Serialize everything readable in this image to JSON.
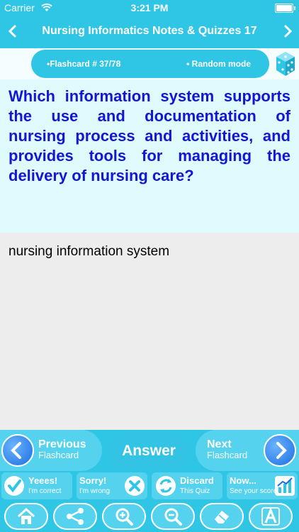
{
  "status": {
    "carrier": "Carrier",
    "time": "3:21 PM"
  },
  "nav": {
    "title": "Nursing Informatics Notes & Quizzes 17"
  },
  "flashcard": {
    "number": "•Flashcard #  37/78",
    "mode": "• Random mode"
  },
  "question": "Which information system supports the use and documentation of nursing process and activities, and provides tools for managing the delivery of nursing care?",
  "answer": "nursing information system",
  "controls": {
    "previous": {
      "line1": "Previous",
      "line2": "Flashcard"
    },
    "answer_label": "Answer",
    "next": {
      "line1": "Next",
      "line2": "Flashcard"
    }
  },
  "actions": {
    "yes": {
      "line1": "Yeees!",
      "line2": "I'm correct"
    },
    "sorry": {
      "line1": "Sorry!",
      "line2": "I'm wrong"
    },
    "discard": {
      "line1": "Discard",
      "line2": "This Quiz"
    },
    "now": {
      "line1": "Now...",
      "line2": "See your score"
    }
  },
  "icons": {
    "home": "home-icon",
    "share": "share-icon",
    "zoom_in": "zoom-in-icon",
    "zoom_out": "zoom-out-icon",
    "clear": "eraser-icon",
    "font": "font-icon"
  },
  "colors": {
    "bar": "#2fc6e6",
    "question_text": "#1416d6",
    "question_bg": "#dffbfd"
  }
}
